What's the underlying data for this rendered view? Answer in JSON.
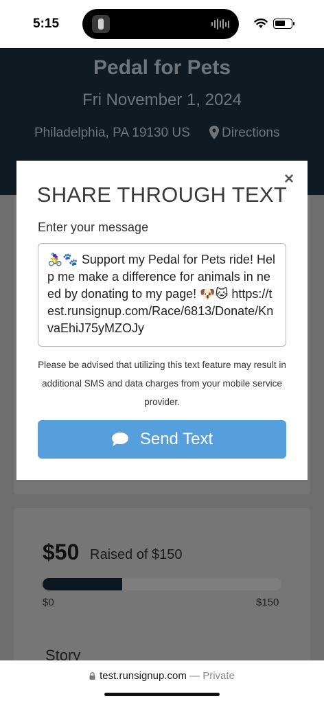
{
  "status_bar": {
    "time": "5:15"
  },
  "page": {
    "event_title": "Pedal for Pets",
    "event_date": "Fri November 1, 2024",
    "location": "Philadelphia, PA 19130 US",
    "directions_label": "Directions",
    "fundraising": {
      "amount": "$50",
      "raised_text": "Raised of $150",
      "progress_fraction": 0.333,
      "min_label": "$0",
      "max_label": "$150"
    },
    "story_heading": "Story"
  },
  "modal": {
    "title": "SHARE THROUGH TEXT",
    "close_label": "×",
    "message_label": "Enter your message",
    "message_value": "🚴‍♀️🐾 Support my Pedal for Pets ride! Help me make a difference for animals in need by donating to my page! 🐶🐱 https://test.runsignup.com/Race/6813/Donate/KnvaEhiJ75yMZOJy",
    "notice": "Please be advised that utilizing this text feature may result in additional SMS and data charges from your mobile service provider.",
    "send_button_label": "Send Text",
    "send_icon": "speech-bubble-icon",
    "accent_color": "#559fdc"
  },
  "browser": {
    "url": "test.runsignup.com",
    "separator": " — ",
    "mode": "Private"
  }
}
